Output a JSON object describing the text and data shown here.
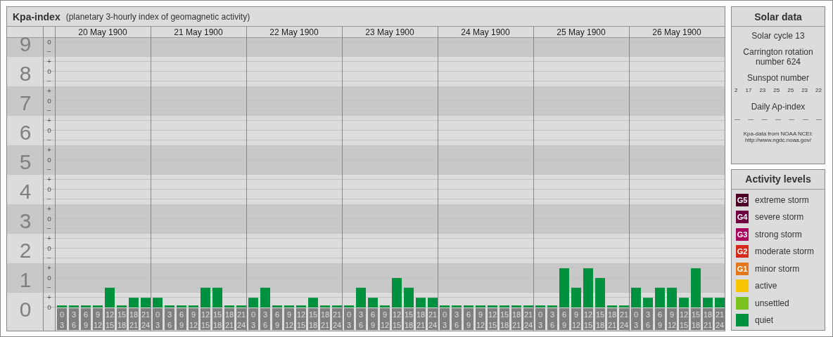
{
  "kpa_panel": {
    "title": "Kpa-index",
    "subtitle": "(planetary 3-hourly index of geomagnetic activity)",
    "days": [
      {
        "date": "20 May 1900",
        "slots": [
          [
            "0",
            "3"
          ],
          [
            "3",
            "6"
          ],
          [
            "6",
            "9"
          ],
          [
            "9",
            "12"
          ],
          [
            "12",
            "15"
          ],
          [
            "15",
            "18"
          ],
          [
            "18",
            "21"
          ],
          [
            "21",
            "24"
          ]
        ]
      },
      {
        "date": "21 May 1900",
        "slots": [
          [
            "0",
            "3"
          ],
          [
            "3",
            "6"
          ],
          [
            "6",
            "9"
          ],
          [
            "9",
            "12"
          ],
          [
            "12",
            "15"
          ],
          [
            "15",
            "18"
          ],
          [
            "18",
            "21"
          ],
          [
            "21",
            "24"
          ]
        ]
      },
      {
        "date": "22 May 1900",
        "slots": [
          [
            "0",
            "3"
          ],
          [
            "3",
            "6"
          ],
          [
            "6",
            "9"
          ],
          [
            "9",
            "12"
          ],
          [
            "12",
            "15"
          ],
          [
            "15",
            "18"
          ],
          [
            "18",
            "21"
          ],
          [
            "21",
            "24"
          ]
        ]
      },
      {
        "date": "23 May 1900",
        "slots": [
          [
            "0",
            "3"
          ],
          [
            "3",
            "6"
          ],
          [
            "6",
            "9"
          ],
          [
            "9",
            "12"
          ],
          [
            "12",
            "15"
          ],
          [
            "15",
            "18"
          ],
          [
            "18",
            "21"
          ],
          [
            "21",
            "24"
          ]
        ]
      },
      {
        "date": "24 May 1900",
        "slots": [
          [
            "0",
            "3"
          ],
          [
            "3",
            "6"
          ],
          [
            "6",
            "9"
          ],
          [
            "9",
            "12"
          ],
          [
            "12",
            "15"
          ],
          [
            "15",
            "18"
          ],
          [
            "18",
            "21"
          ],
          [
            "21",
            "24"
          ]
        ]
      },
      {
        "date": "25 May 1900",
        "slots": [
          [
            "0",
            "3"
          ],
          [
            "3",
            "6"
          ],
          [
            "6",
            "9"
          ],
          [
            "9",
            "12"
          ],
          [
            "12",
            "15"
          ],
          [
            "15",
            "18"
          ],
          [
            "18",
            "21"
          ],
          [
            "21",
            "24"
          ]
        ]
      },
      {
        "date": "26 May 1900",
        "slots": [
          [
            "0",
            "3"
          ],
          [
            "3",
            "6"
          ],
          [
            "6",
            "9"
          ],
          [
            "9",
            "12"
          ],
          [
            "12",
            "15"
          ],
          [
            "15",
            "18"
          ],
          [
            "18",
            "21"
          ],
          [
            "21",
            "24"
          ]
        ]
      }
    ],
    "chart_data": {
      "type": "bar",
      "ylim": [
        0,
        9
      ],
      "yticks": [
        {
          "value": 0,
          "label": "0"
        },
        {
          "value": 1,
          "label": "1"
        },
        {
          "value": 2,
          "label": "2"
        },
        {
          "value": 3,
          "label": "3"
        },
        {
          "value": 4,
          "label": "4"
        },
        {
          "value": 5,
          "label": "5"
        },
        {
          "value": 6,
          "label": "6"
        },
        {
          "value": 7,
          "label": "7"
        },
        {
          "value": 8,
          "label": "8"
        },
        {
          "value": 9,
          "label": "9"
        }
      ],
      "grid": true,
      "series": [
        {
          "color": "#00913f",
          "values": [
            0,
            0,
            0,
            0,
            0.67,
            0,
            0.33,
            0.33,
            0.33,
            0,
            0,
            0,
            0.67,
            0.67,
            0,
            0,
            0.33,
            0.67,
            0,
            0,
            0,
            0.33,
            0,
            0,
            0,
            0.67,
            0.33,
            0,
            1,
            0.67,
            0.33,
            0.33,
            0,
            0,
            0,
            0,
            0,
            0,
            0,
            0,
            0,
            0,
            1.33,
            0.67,
            1.33,
            1,
            0,
            0,
            0.67,
            0.33,
            0.67,
            0.67,
            0.33,
            1.33,
            0.33,
            0.33
          ]
        }
      ]
    },
    "minor_tick_labels": [
      "o",
      "−",
      "+",
      "o",
      "−",
      "+",
      "o",
      "−",
      "+",
      "o",
      "−",
      "+",
      "o",
      "−",
      "+",
      "o",
      "−",
      "+",
      "o",
      "−",
      "+",
      "o",
      "−",
      "+",
      "o",
      "−",
      "+",
      "o"
    ]
  },
  "solar_data": {
    "title": "Solar data",
    "solar_cycle": "Solar cycle 13",
    "carrington": "Carrington rotation number 624",
    "sunspot_heading": "Sunspot number",
    "sunspots": [
      "2",
      "17",
      "23",
      "25",
      "25",
      "23",
      "22"
    ],
    "ap_heading": "Daily Ap-index",
    "ap_values": [
      "—",
      "—",
      "—",
      "—",
      "—",
      "—",
      "—"
    ],
    "source": "Kpa-data from NOAA NCEI:",
    "source_url": "http://www.ngdc.noaa.gov/"
  },
  "activity_levels": {
    "title": "Activity levels",
    "items": [
      {
        "badge": "G5",
        "label": "extreme storm",
        "color": "#4d0026"
      },
      {
        "badge": "G4",
        "label": "severe storm",
        "color": "#6e0042"
      },
      {
        "badge": "G3",
        "label": "strong storm",
        "color": "#a8005c"
      },
      {
        "badge": "G2",
        "label": "moderate storm",
        "color": "#d62b1a"
      },
      {
        "badge": "G1",
        "label": "minor storm",
        "color": "#e6761c"
      },
      {
        "label": "active",
        "color": "#f7c400"
      },
      {
        "label": "unsettled",
        "color": "#7cc21e"
      },
      {
        "label": "quiet",
        "color": "#00913f"
      }
    ]
  }
}
